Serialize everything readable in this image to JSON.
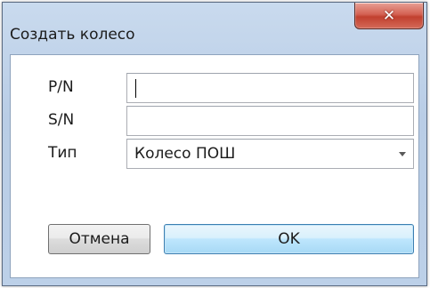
{
  "window": {
    "title": "Создать колесо",
    "close_icon": "close-icon"
  },
  "form": {
    "pn": {
      "label": "P/N",
      "value": ""
    },
    "sn": {
      "label": "S/N",
      "value": ""
    },
    "type": {
      "label": "Тип",
      "selected": "Колесо ПОШ",
      "icon": "chevron-down-icon"
    }
  },
  "buttons": {
    "cancel_label": "Отмена",
    "ok_label": "OK"
  },
  "colors": {
    "title_bar": "#bcd0e8",
    "close_button": "#c1402f",
    "ok_button": "#bee6fd"
  }
}
